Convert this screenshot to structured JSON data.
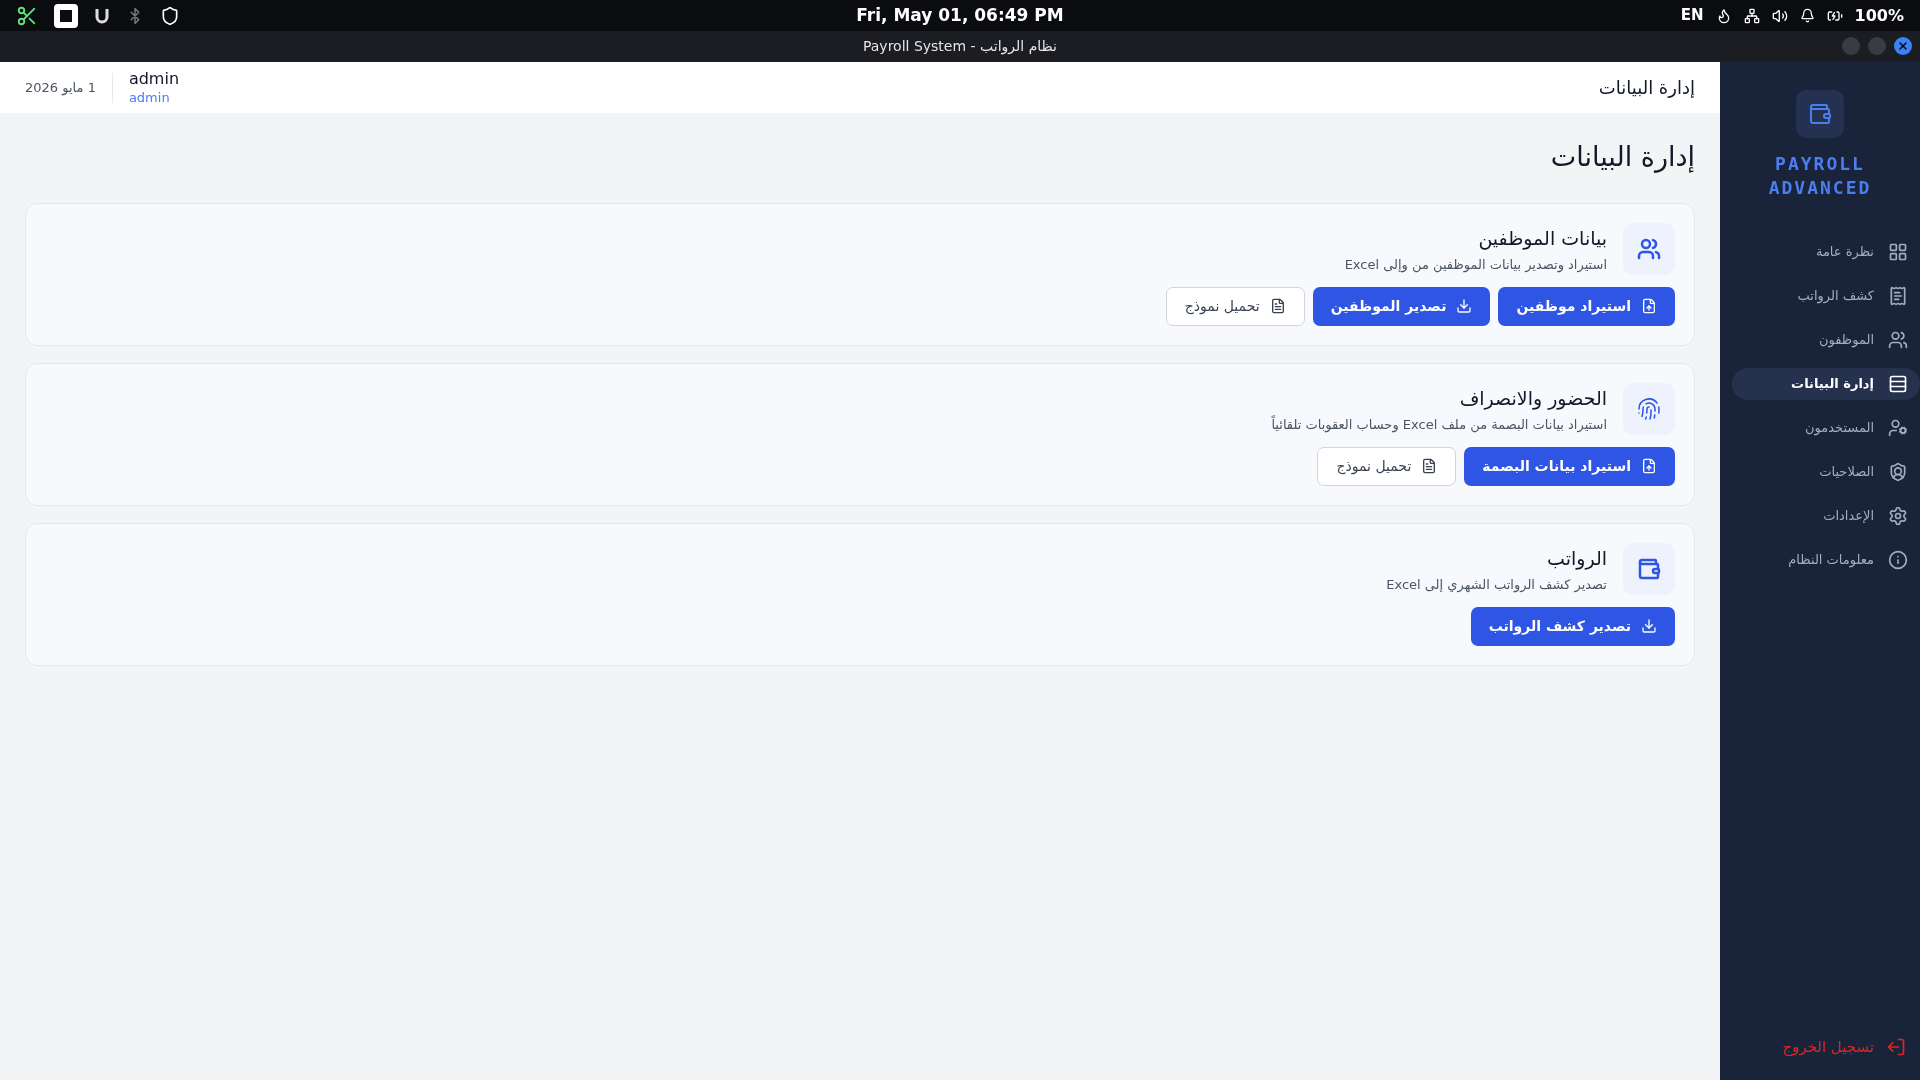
{
  "system_bar": {
    "clock": "Fri, May 01, 06:49 PM",
    "keyboard": "EN",
    "battery": "100%"
  },
  "window": {
    "title": "Payroll System - نظام الرواتب"
  },
  "sidebar": {
    "brand": [
      "PAYROLL",
      "ADVANCED"
    ],
    "items": [
      {
        "kind": "overview",
        "label": "نظرة عامة",
        "selected": false
      },
      {
        "kind": "payslip",
        "label": "كشف الرواتب",
        "selected": false
      },
      {
        "kind": "employees",
        "label": "الموظفون",
        "selected": false
      },
      {
        "kind": "data",
        "label": "إدارة البيانات",
        "selected": true
      },
      {
        "kind": "users",
        "label": "المستخدمون",
        "selected": false
      },
      {
        "kind": "permissions",
        "label": "الصلاحيات",
        "selected": false
      },
      {
        "kind": "settings",
        "label": "الإعدادات",
        "selected": false
      },
      {
        "kind": "info",
        "label": "معلومات النظام",
        "selected": false
      }
    ],
    "logout": "تسجيل الخروج"
  },
  "header": {
    "title": "إدارة البيانات",
    "user_name": "admin",
    "user_role": "admin",
    "date": "1 مايو 2026"
  },
  "page": {
    "title": "إدارة البيانات",
    "cards": [
      {
        "kind": "employees",
        "title": "بيانات الموظفين",
        "description": "استيراد وتصدير بيانات الموظفين من وإلى Excel",
        "buttons": [
          {
            "kind": "import",
            "label": "استيراد موظفين"
          },
          {
            "kind": "export",
            "label": "تصدير الموظفين"
          },
          {
            "kind": "template",
            "label": "تحميل نموذج"
          }
        ]
      },
      {
        "kind": "attendance",
        "title": "الحضور والانصراف",
        "description": "استيراد بيانات البصمة من ملف Excel وحساب العقوبات تلقائياً",
        "buttons": [
          {
            "kind": "import",
            "label": "استيراد بيانات البصمة"
          },
          {
            "kind": "template",
            "label": "تحميل نموذج"
          }
        ]
      },
      {
        "kind": "payroll",
        "title": "الرواتب",
        "description": "تصدير كشف الرواتب الشهري إلى Excel",
        "buttons": [
          {
            "kind": "export",
            "label": "تصدير كشف الرواتب"
          }
        ]
      }
    ]
  }
}
